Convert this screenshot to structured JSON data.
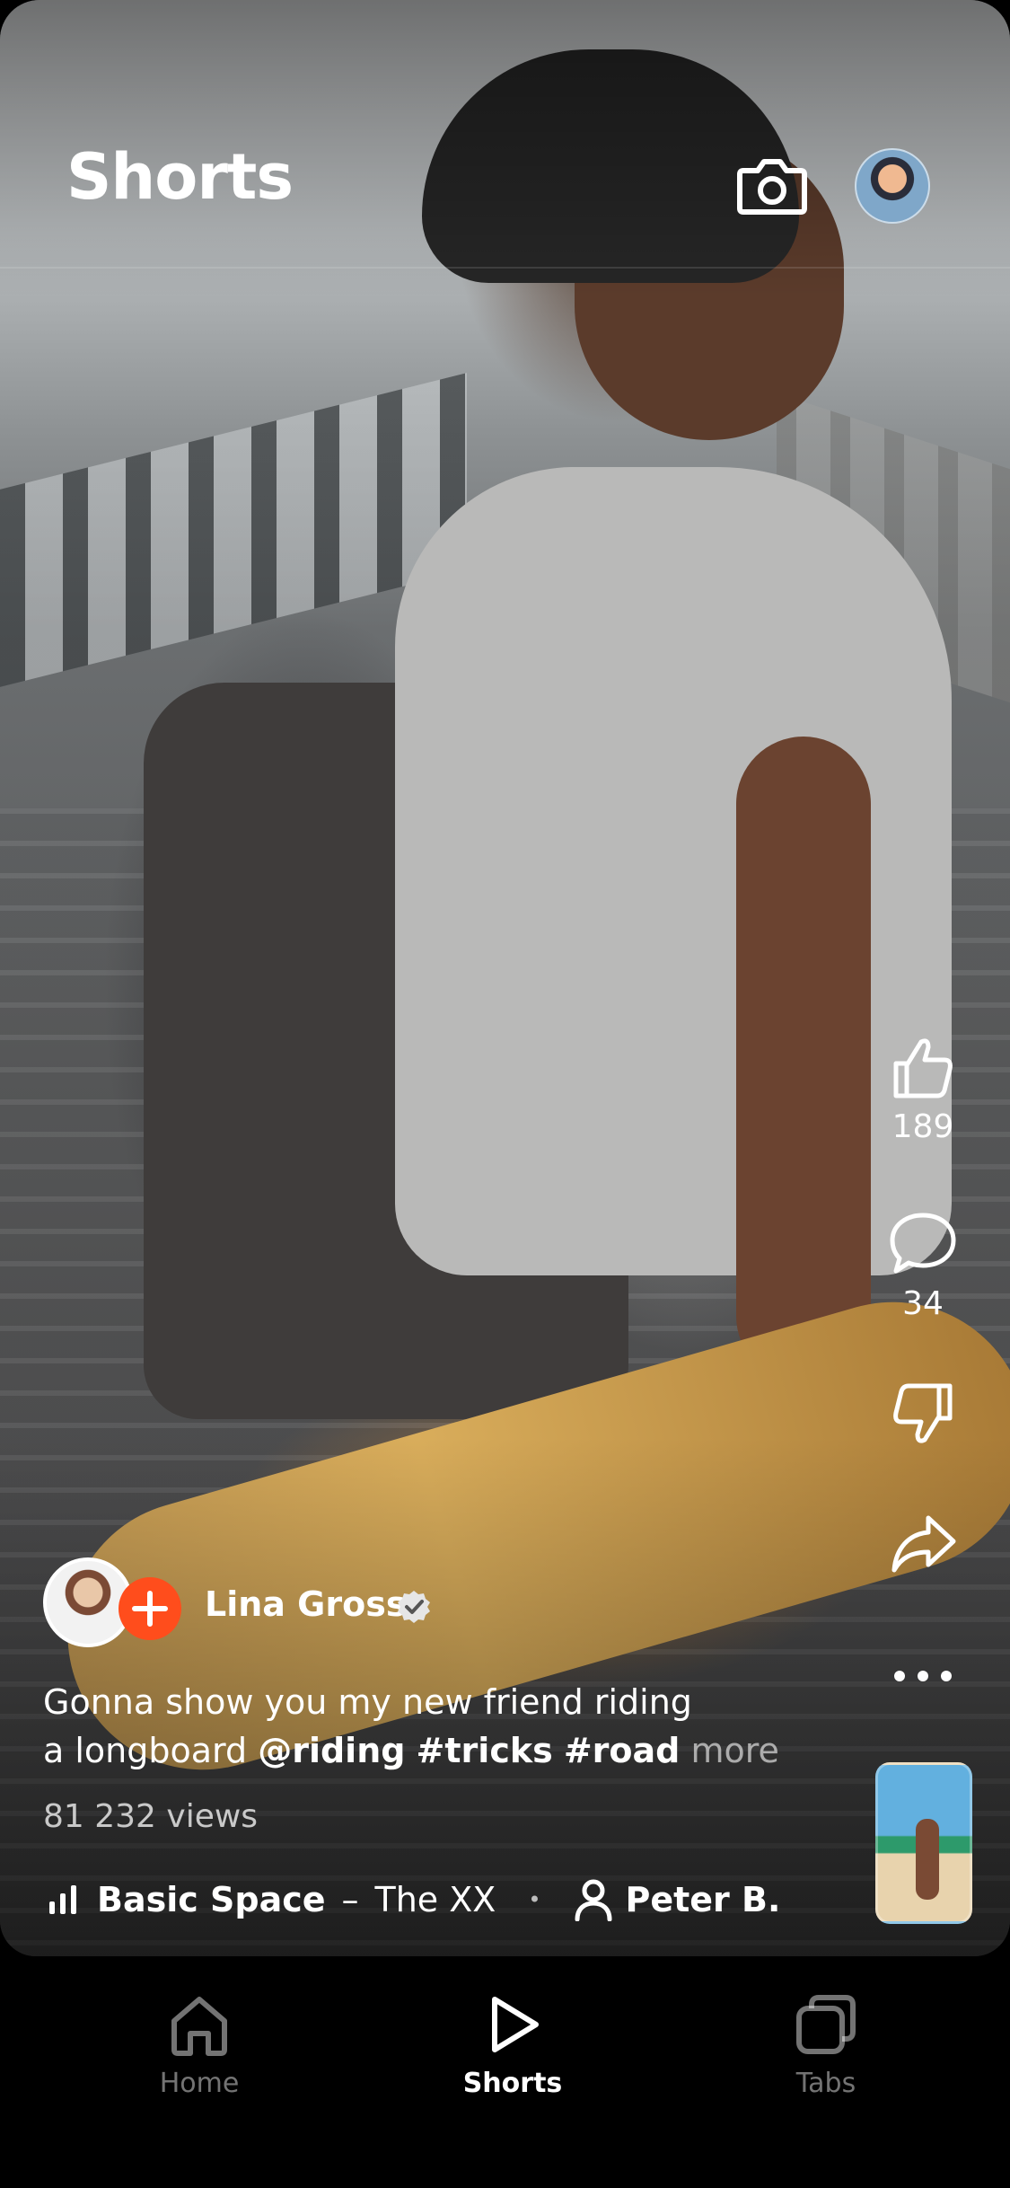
{
  "header": {
    "title": "Shorts",
    "camera_icon": "camera-icon",
    "profile_icon": "profile-avatar"
  },
  "actions": {
    "like": {
      "icon": "thumbs-up-icon",
      "count": "189"
    },
    "comment": {
      "icon": "comment-icon",
      "count": "34"
    },
    "dislike": {
      "icon": "thumbs-down-icon"
    },
    "share": {
      "icon": "share-icon"
    },
    "more": {
      "icon": "more-horizontal-icon"
    }
  },
  "post": {
    "author": "Lina Gross",
    "verified": true,
    "caption_line1": "Gonna show you my new friend riding",
    "caption_line2_prefix": "a longboard",
    "tags": [
      "@riding",
      "#tricks",
      "#road"
    ],
    "more_label": "more",
    "views": "81 232 views",
    "music_title": "Basic Space",
    "music_separator": "–",
    "music_artist": "The XX",
    "dot": "•",
    "credit": "Peter B."
  },
  "tabs": [
    {
      "label": "Home",
      "icon": "home-icon",
      "active": false
    },
    {
      "label": "Shorts",
      "icon": "play-icon",
      "active": true
    },
    {
      "label": "Tabs",
      "icon": "tabs-icon",
      "active": false
    }
  ],
  "colors": {
    "accent": "#ff4d1c",
    "background": "#000000",
    "text": "#ffffff"
  }
}
